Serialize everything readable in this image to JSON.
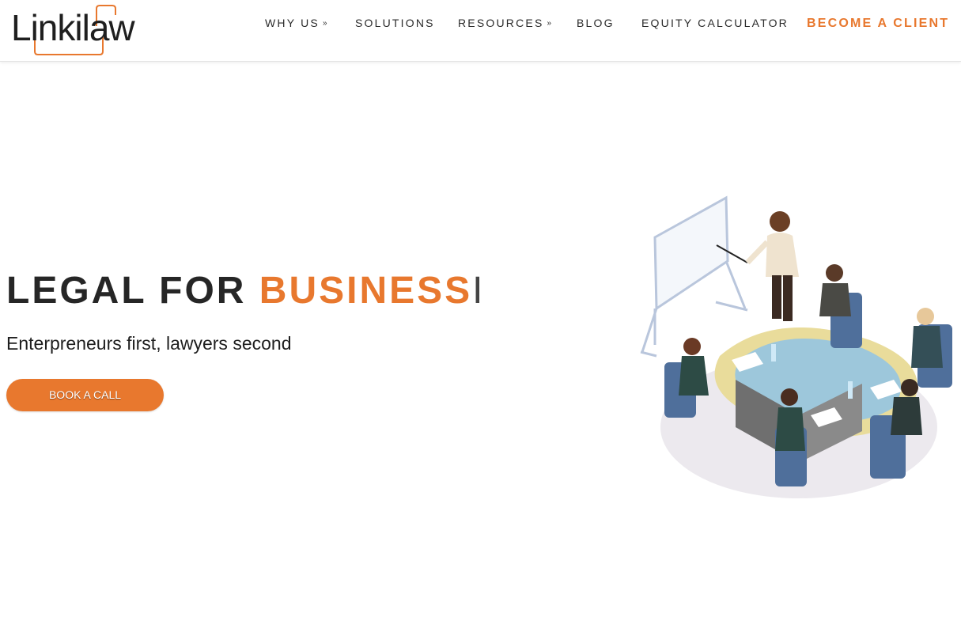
{
  "brand": {
    "name": "Linkilaw",
    "accent_color": "#e8782e",
    "text_color": "#262626"
  },
  "nav": {
    "items": [
      {
        "label": "WHY US",
        "has_dropdown": true
      },
      {
        "label": "SOLUTIONS",
        "has_dropdown": false
      },
      {
        "label": "RESOURCES",
        "has_dropdown": true
      },
      {
        "label": "BLOG",
        "has_dropdown": false
      },
      {
        "label": "EQUITY CALCULATOR",
        "has_dropdown": false
      }
    ],
    "cta_label": "BECOME A CLIENT",
    "dropdown_icon": "double-chevron-down-icon"
  },
  "hero": {
    "headline_prefix": "LEGAL FOR ",
    "headline_accent": "BUSINESS",
    "cursor": "I",
    "subheadline": "Enterpreneurs first, lawyers second",
    "button_label": "BOOK A CALL",
    "illustration": "business-meeting-illustration"
  }
}
